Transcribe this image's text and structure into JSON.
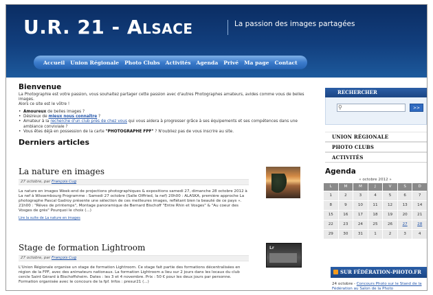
{
  "header": {
    "title_prefix": "U.R. 21 - ",
    "title_suffix": "Alsace",
    "tagline": "La passion des images partagées"
  },
  "nav": {
    "items": [
      "Accueil",
      "Union Régionale",
      "Photo Clubs",
      "Activités",
      "Agenda",
      "Privé",
      "Ma page",
      "Contact"
    ]
  },
  "welcome": {
    "heading": "Bienvenue",
    "intro1": "La Photographie est votre passion, vous souhaitez partager cette passion avec d'autres Photographes amateurs, avides comme vous de belles images.",
    "intro2": "Alors ce site est le vôtre !",
    "bullets": [
      {
        "bold": "Amoureux",
        "text": " de belles images ?"
      },
      {
        "pre": "Désireux de ",
        "link": "mieux nous connaître",
        "post": " ?"
      },
      {
        "pre": "Amateur à la ",
        "link": "recherche d'un club près de chez vous",
        "post": " qui vous aidera à progresser grâce à ses équipements et ses compétences dans une ambiance conviviale ?"
      },
      {
        "pre": "Vous êtes déjà en possession de la carte ",
        "bold": "\"PHOTOGRAPHE FPF\"",
        "post": " ? N'oubliez pas de vous inscrire au site."
      }
    ]
  },
  "articles": {
    "heading": "Derniers articles",
    "items": [
      {
        "title": "La nature en images",
        "meta_date": "27 octobre",
        "meta_by": ", par ",
        "meta_author": "François Cug",
        "body": "La nature en images Week-end de projections photographiques & expositions samedi 27, dimanche 28 octobre 2012 à La nef à Wissembourg Programme : Samedi 27 octobre (Salle Olffried, la nef) 20h00 : ALASKA, première approche La photographe Pascal Gadroy présente une sélection de ces meilleures images, reflétant bien la beauté de ce pays «. 21h00 : \"Rêves de printemps\", Montage panoramique de Bernard Bischoff \"Entre Rhin et Vosges\" & \"Au coeur des Vosges de grès\" Pourquoi le choix (...)",
        "more": "Lire la suite de La nature en images"
      },
      {
        "title": "Stage de formation Lightroom",
        "meta_date": "27 octobre",
        "meta_by": ", par ",
        "meta_author": "François Cug",
        "body": "L'Union Régionale organise un stage de formation Lightroom. Ce stage fait partie des formations décentralisées en région de la FPF, avec des animateurs nationaux. La formation Lightroom a lieu sur 2 jours dans les locaux du club cercle Saint Gérard à Bischoffsheim. Dates : les 3 et 4 novembre. Prix : 50 € pour les deux jours par personne. Formation organisée avec le concours de la fpf. Infos : presur21 (...)",
        "thumb_label": "Lr"
      }
    ]
  },
  "sidebar": {
    "search_heading": "Rechercher",
    "search_icon": "magnifier-icon",
    "search_button": ">>",
    "menu": [
      "Union Régionale",
      "Photo Clubs",
      "Activités"
    ]
  },
  "agenda": {
    "heading": "Agenda",
    "caption": "« octobre 2012 »",
    "dow": [
      "L",
      "M",
      "M",
      "J",
      "V",
      "S",
      "D"
    ],
    "weeks": [
      [
        "1",
        "2",
        "3",
        "4",
        "5",
        "6",
        "7"
      ],
      [
        "8",
        "9",
        "10",
        "11",
        "12",
        "13",
        "14"
      ],
      [
        "15",
        "16",
        "17",
        "18",
        "19",
        "20",
        "21"
      ],
      [
        "22",
        "23",
        "24",
        "25",
        "26",
        "27",
        "28"
      ],
      [
        "29",
        "30",
        "31",
        "1",
        "2",
        "3",
        "4"
      ]
    ],
    "link_days": [
      "27",
      "28"
    ]
  },
  "federation": {
    "heading": "Sur Fédération-Photo.fr",
    "date": "24 octobre - ",
    "link": "Concours Photo sur le Stand de la Fédération au Salon de la Photo"
  },
  "colors": {
    "header_dark": "#0b2d63",
    "nav_blue": "#3c7ccc",
    "link": "#2255aa",
    "calendar_head": "#8a8a8a"
  }
}
